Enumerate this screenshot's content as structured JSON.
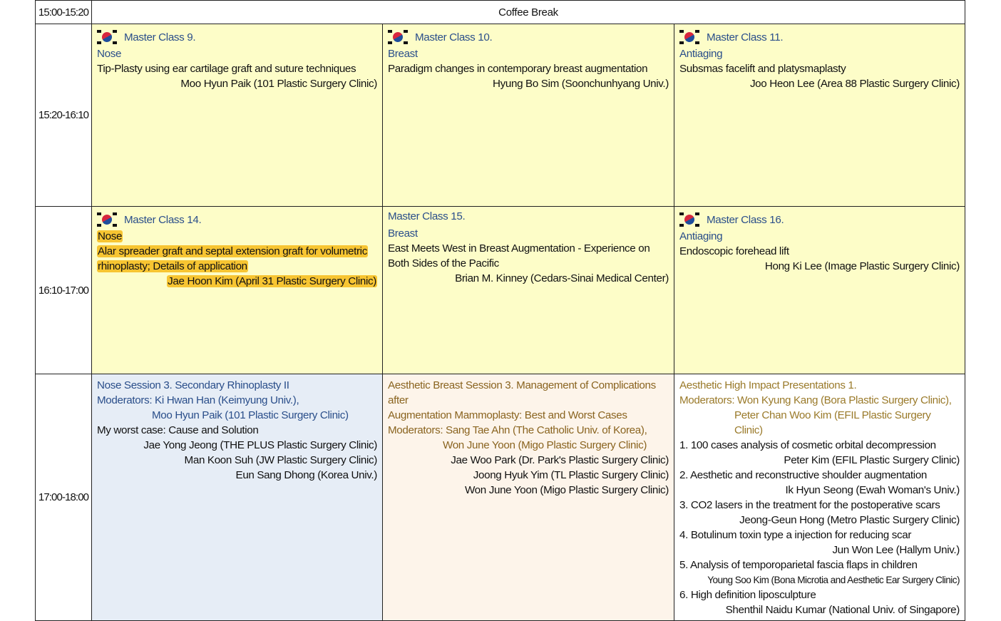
{
  "rows": [
    {
      "time": "15:00-15:20",
      "label": "Coffee Break"
    },
    {
      "time": "15:20-16:10"
    },
    {
      "time": "16:10-17:00"
    },
    {
      "time": "17:00-18:00"
    }
  ],
  "row2": [
    {
      "title": "Master Class 9.",
      "topic": "Nose",
      "talk": "Tip-Plasty using ear cartilage graft and suture techniques",
      "speaker": "Moo Hyun Paik (101 Plastic Surgery Clinic)"
    },
    {
      "title": "Master Class 10.",
      "topic": "Breast",
      "talk": "Paradigm changes in contemporary breast augmentation",
      "speaker": "Hyung Bo Sim (Soonchunhyang Univ.)"
    },
    {
      "title": "Master Class 11.",
      "topic": "Antiaging",
      "talk": "Subsmas facelift and platysmaplasty",
      "speaker": "Joo Heon Lee (Area 88 Plastic Surgery Clinic)"
    }
  ],
  "row3": [
    {
      "title": "Master Class 14.",
      "topic": "Nose",
      "talk1": "Alar spreader graft and septal extension graft for volumetric",
      "talk2": "rhinoplasty; Details of application",
      "speaker": "Jae Hoon Kim (April 31 Plastic Surgery Clinic)"
    },
    {
      "title": "Master Class 15.",
      "topic": "Breast",
      "talk1": "East Meets West in Breast Augmentation - Experience on",
      "talk2": "Both Sides of the Pacific",
      "speaker": "Brian M. Kinney (Cedars-Sinai Medical Center)"
    },
    {
      "title": "Master Class 16.",
      "topic": "Antiaging",
      "talk": "Endoscopic forehead lift",
      "speaker": "Hong Ki Lee (Image Plastic Surgery Clinic)"
    }
  ],
  "row4": {
    "nose": {
      "title": "Nose Session 3. Secondary Rhinoplasty II",
      "mod1": "Moderators: Ki Hwan Han (Keimyung Univ.),",
      "mod2": "Moo Hyun Paik (101 Plastic Surgery Clinic)",
      "talk": "My worst case: Cause and Solution",
      "speakers": [
        "Jae Yong Jeong (THE PLUS Plastic Surgery Clinic)",
        "Man Koon Suh (JW Plastic Surgery Clinic)",
        "Eun Sang Dhong (Korea Univ.)"
      ]
    },
    "breast": {
      "title1": "Aesthetic Breast Session 3. Management of Complications after",
      "title2": "Augmentation Mammoplasty: Best and Worst Cases",
      "mod1": "Moderators: Sang Tae Ahn (The Catholic Univ. of Korea),",
      "mod2": "Won June Yoon (Migo Plastic Surgery Clinic)",
      "speakers": [
        "Jae Woo Park (Dr. Park's Plastic Surgery Clinic)",
        "Joong Hyuk Yim (TL Plastic Surgery Clinic)",
        "Won June Yoon (Migo Plastic Surgery Clinic)"
      ]
    },
    "impact": {
      "title": "Aesthetic High Impact Presentations 1.",
      "mod1": "Moderators: Won Kyung Kang (Bora Plastic Surgery Clinic),",
      "mod2": "Peter Chan Woo Kim (EFIL Plastic Surgery Clinic)",
      "items": [
        {
          "talk": "1. 100 cases analysis of cosmetic orbital decompression",
          "speaker": "Peter Kim (EFIL Plastic Surgery Clinic)"
        },
        {
          "talk": "2. Aesthetic and reconstructive shoulder augmentation",
          "speaker": "Ik Hyun Seong (Ewah Woman's Univ.)"
        },
        {
          "talk": "3. CO2 lasers in the treatment for the postoperative scars",
          "speaker": "Jeong-Geun Hong (Metro Plastic Surgery Clinic)"
        },
        {
          "talk": "4. Botulinum toxin type a injection for reducing scar",
          "speaker": "Jun Won Lee (Hallym Univ.)"
        },
        {
          "talk": "5. Analysis of temporoparietal fascia flaps in children",
          "speaker": "Young Soo Kim (Bona Microtia and Aesthetic Ear Surgery Clinic)"
        },
        {
          "talk": "6. High definition liposculpture",
          "speaker": "Shenthil Naidu Kumar (National Univ. of Singapore)"
        }
      ]
    }
  }
}
